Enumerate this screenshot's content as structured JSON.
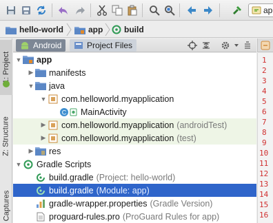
{
  "toolbar": {
    "icons": [
      "save-icon",
      "save-all-icon",
      "sync-icon",
      "undo-icon",
      "redo-icon",
      "cut-icon",
      "copy-icon",
      "paste-icon",
      "find-icon",
      "replace-icon",
      "back-icon",
      "forward-icon",
      "build-icon"
    ],
    "run_config_label": "app"
  },
  "breadcrumb": {
    "items": [
      "hello-world",
      "app",
      "build"
    ]
  },
  "side_tabs": {
    "project": "1: Project",
    "structure": "Z: Structure",
    "captures": "Captures"
  },
  "panel": {
    "tabs": [
      "Android",
      "Project Files"
    ]
  },
  "tree": {
    "rows": [
      {
        "label": "app",
        "sub": ""
      },
      {
        "label": "manifests",
        "sub": ""
      },
      {
        "label": "java",
        "sub": ""
      },
      {
        "label": "com.helloworld.myapplication",
        "sub": ""
      },
      {
        "label": "MainActivity",
        "sub": ""
      },
      {
        "label": "com.helloworld.myapplication",
        "sub": "(androidTest)"
      },
      {
        "label": "com.helloworld.myapplication",
        "sub": "(test)"
      },
      {
        "label": "res",
        "sub": ""
      },
      {
        "label": "Gradle Scripts",
        "sub": ""
      },
      {
        "label": "build.gradle",
        "sub": "(Project: hello-world)"
      },
      {
        "label": "build.gradle",
        "sub": "(Module: app)"
      },
      {
        "label": "gradle-wrapper.properties",
        "sub": "(Gradle Version)"
      },
      {
        "label": "proguard-rules.pro",
        "sub": "(ProGuard Rules for app)"
      }
    ]
  },
  "gutter": {
    "lines": [
      "1",
      "2",
      "3",
      "4",
      "5",
      "6",
      "7",
      "8",
      "9",
      "10",
      "11",
      "12",
      "13",
      "14",
      "15",
      "16"
    ]
  },
  "colors": {
    "selection": "#2f65ca",
    "android_green": "#6fae3a",
    "folder_blue": "#5b87c5",
    "line_number_red": "#d03030"
  }
}
